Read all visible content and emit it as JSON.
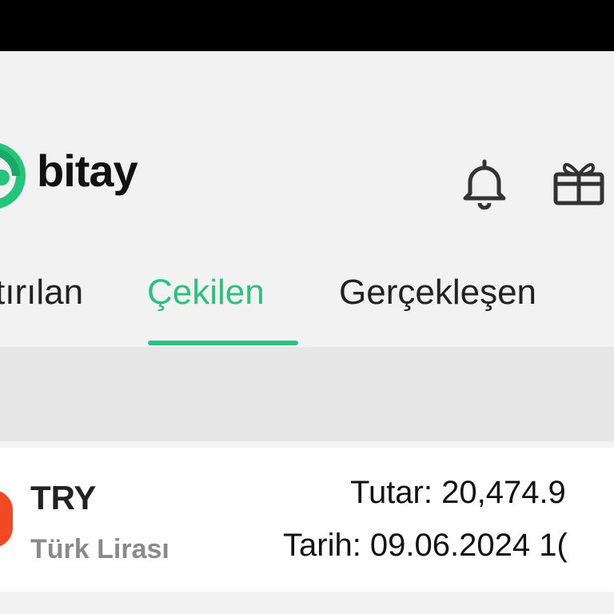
{
  "app": {
    "brand": "bitay",
    "brand_color": "#2ec07e"
  },
  "header": {
    "icons": [
      {
        "name": "bell-icon"
      },
      {
        "name": "gift-icon"
      }
    ]
  },
  "tabs": [
    {
      "label": "tırılan",
      "active": false
    },
    {
      "label": "Çekilen",
      "active": true
    },
    {
      "label": "Gerçekleşen",
      "active": false
    }
  ],
  "transaction": {
    "code": "TRY",
    "name": "Türk Lirası",
    "amount_label": "Tutar: 20,474.9",
    "date_label": "Tarih: 09.06.2024 1("
  }
}
